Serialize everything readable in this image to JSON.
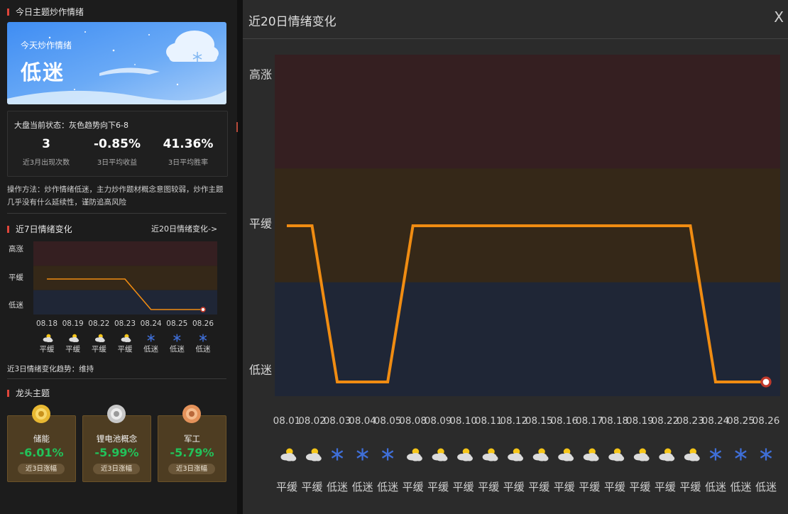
{
  "left": {
    "section_today": "今日主题炒作情绪",
    "banner": {
      "subtitle": "今天炒作情绪",
      "mood": "低迷"
    },
    "status_line": "大盘当前状态：灰色趋势向下6-8",
    "stats": [
      {
        "value": "3",
        "label": "近3月出现次数"
      },
      {
        "value": "-0.85%",
        "label": "3日平均收益"
      },
      {
        "value": "41.36%",
        "label": "3日平均胜率"
      }
    ],
    "method_text": "操作方法：炒作情绪低迷，主力炒作题材概念意图较弱，炒作主题几乎没有什么延续性，谨防追高风险",
    "section_7day": "近7日情绪变化",
    "link_20day": "近20日情绪变化->",
    "trend_text": "近3日情绪变化趋势：维持",
    "section_leader": "龙头主题",
    "cards": [
      {
        "name": "储能",
        "pct": "-6.01%",
        "btn": "近3日涨幅",
        "medal": "gold-medal-icon",
        "color": "#e8b832"
      },
      {
        "name": "锂电池概念",
        "pct": "-5.99%",
        "btn": "近3日涨幅",
        "medal": "silver-medal-icon",
        "color": "#c8c8c8"
      },
      {
        "name": "军工",
        "pct": "-5.79%",
        "btn": "近3日涨幅",
        "medal": "bronze-medal-icon",
        "color": "#e4925a"
      }
    ]
  },
  "right": {
    "title": "近20日情绪变化",
    "close": "X"
  },
  "colors": {
    "line": "#f08c12",
    "band_high": "#351f21",
    "band_mid": "#352818",
    "band_low": "#1f2636",
    "snow": "#3f6fd8"
  },
  "chart_data": [
    {
      "type": "line",
      "title": "近7日情绪变化",
      "levels": [
        "低迷",
        "平缓",
        "高涨"
      ],
      "x": [
        "08.18",
        "08.19",
        "08.22",
        "08.23",
        "08.24",
        "08.25",
        "08.26"
      ],
      "y": [
        "平缓",
        "平缓",
        "平缓",
        "平缓",
        "低迷",
        "低迷",
        "低迷"
      ],
      "icons": [
        "sun-cloud-icon",
        "sun-cloud-icon",
        "sun-cloud-icon",
        "sun-cloud-icon",
        "snowflake-icon",
        "snowflake-icon",
        "snowflake-icon"
      ],
      "labels": [
        "平缓",
        "平缓",
        "平缓",
        "平缓",
        "低迷",
        "低迷",
        "低迷"
      ]
    },
    {
      "type": "line",
      "title": "近20日情绪变化",
      "levels": [
        "低迷",
        "平缓",
        "高涨"
      ],
      "x": [
        "08.01",
        "08.02",
        "08.03",
        "08.04",
        "08.05",
        "08.08",
        "08.09",
        "08.10",
        "08.11",
        "08.12",
        "08.15",
        "08.16",
        "08.17",
        "08.18",
        "08.19",
        "08.22",
        "08.23",
        "08.24",
        "08.25",
        "08.26"
      ],
      "y": [
        "平缓",
        "平缓",
        "低迷",
        "低迷",
        "低迷",
        "平缓",
        "平缓",
        "平缓",
        "平缓",
        "平缓",
        "平缓",
        "平缓",
        "平缓",
        "平缓",
        "平缓",
        "平缓",
        "平缓",
        "低迷",
        "低迷",
        "低迷"
      ],
      "icons": [
        "sun-cloud-icon",
        "sun-cloud-icon",
        "snowflake-icon",
        "snowflake-icon",
        "snowflake-icon",
        "sun-cloud-icon",
        "sun-cloud-icon",
        "sun-cloud-icon",
        "sun-cloud-icon",
        "sun-cloud-icon",
        "sun-cloud-icon",
        "sun-cloud-icon",
        "sun-cloud-icon",
        "sun-cloud-icon",
        "sun-cloud-icon",
        "sun-cloud-icon",
        "sun-cloud-icon",
        "snowflake-icon",
        "snowflake-icon",
        "snowflake-icon"
      ],
      "labels": [
        "平缓",
        "平缓",
        "低迷",
        "低迷",
        "低迷",
        "平缓",
        "平缓",
        "平缓",
        "平缓",
        "平缓",
        "平缓",
        "平缓",
        "平缓",
        "平缓",
        "平缓",
        "平缓",
        "平缓",
        "低迷",
        "低迷",
        "低迷"
      ]
    }
  ]
}
